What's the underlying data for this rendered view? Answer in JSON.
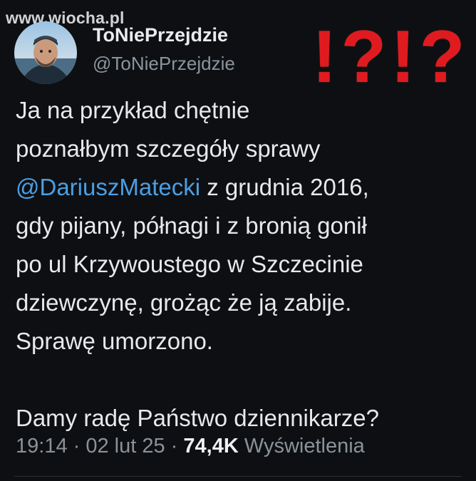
{
  "watermark": "www.wiocha.pl",
  "tweet": {
    "display_name": "ToNiePrzejdzie",
    "handle": "@ToNiePrzejdzie",
    "overlay_text": "!?!?",
    "body": {
      "line1": "Ja na przykład chętnie",
      "line2": "poznałbym szczegóły sprawy",
      "mention": "@DariuszMatecki",
      "line3_rest": " z grudnia 2016,",
      "line4": "gdy pijany, półnagi i z bronią gonił",
      "line5": "po ul Krzywoustego w Szczecinie",
      "line6": "dziewczynę, grożąc że ją zabije.",
      "line7": "Sprawę umorzono.",
      "line8": "Damy radę Państwo dziennikarze?"
    },
    "meta": {
      "time": "19:14",
      "sep1": " · ",
      "date": "02 lut 25",
      "sep2": " · ",
      "views_count": "74,4K",
      "views_label": " Wyświetlenia"
    }
  },
  "colors": {
    "background": "#0e0f12",
    "mention": "#4a9fe4",
    "overlay_red": "#e01b20",
    "muted": "#8a939a"
  },
  "icons": {
    "avatar": "profile-photo"
  }
}
